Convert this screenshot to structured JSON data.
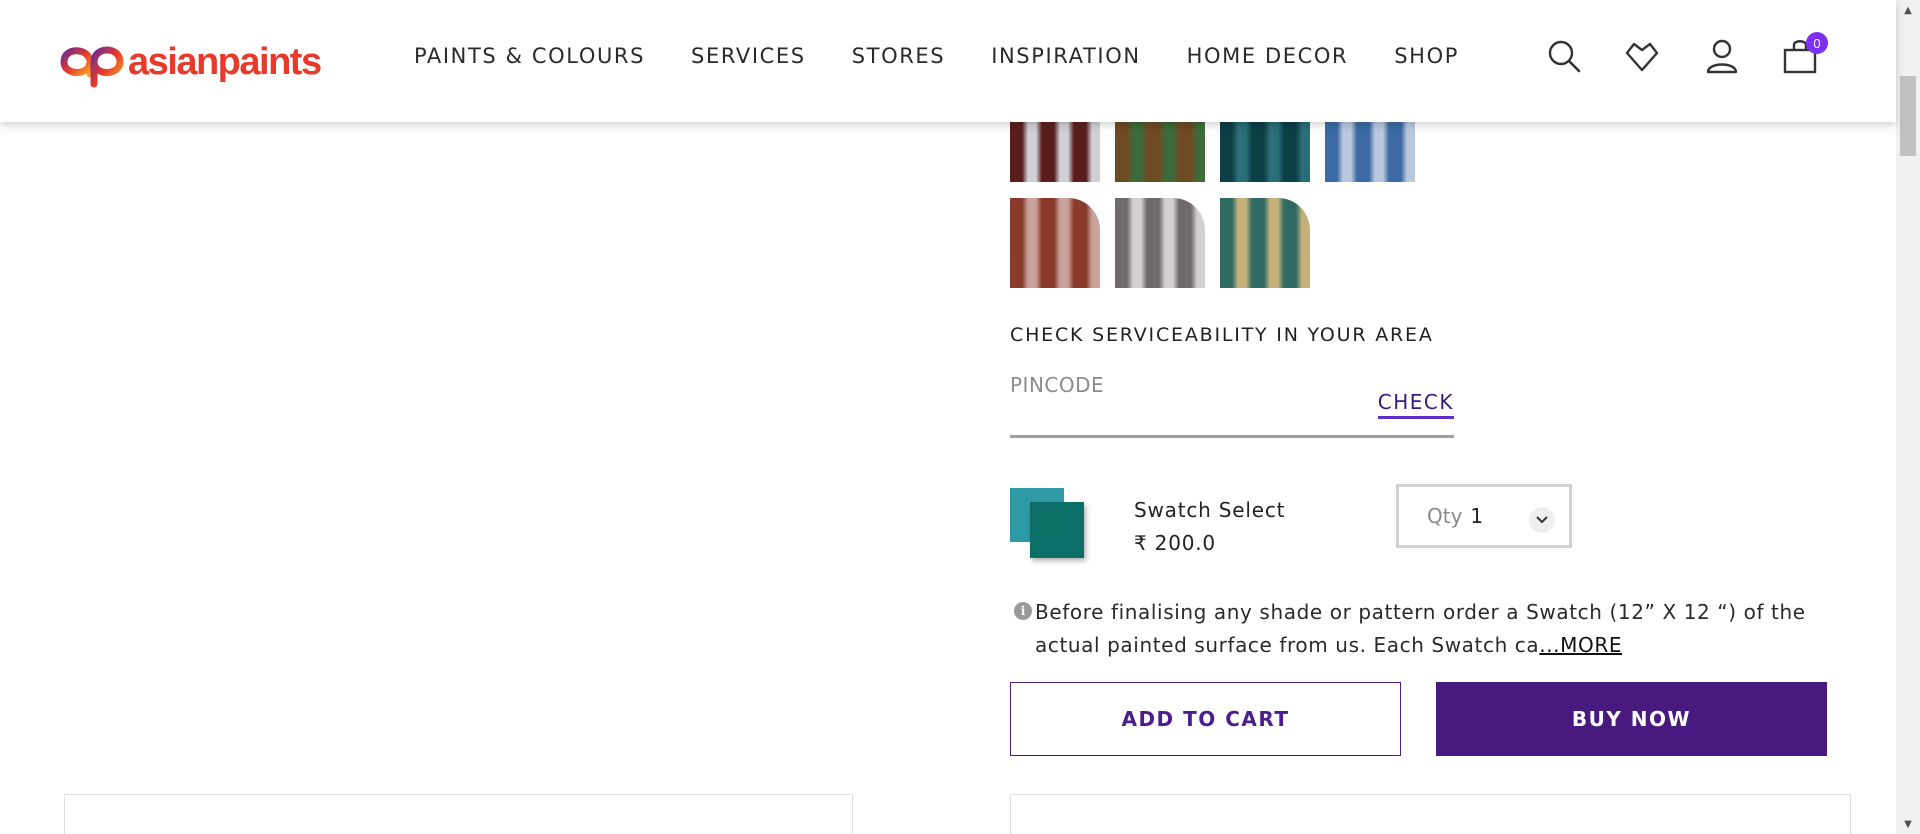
{
  "brand": {
    "name": "asianpaints"
  },
  "nav": {
    "items": [
      {
        "label": "PAINTS & COLOURS"
      },
      {
        "label": "SERVICES"
      },
      {
        "label": "STORES"
      },
      {
        "label": "INSPIRATION"
      },
      {
        "label": "HOME DECOR"
      },
      {
        "label": "SHOP"
      }
    ]
  },
  "header_icons": [
    "search-icon",
    "wishlist-heart-icon",
    "user-account-icon",
    "cart-bag-icon"
  ],
  "cart": {
    "count": "0"
  },
  "swatches": [
    {
      "name": "swatch-color-1",
      "selected": true,
      "colors": [
        "#5a1e1e",
        "#cfcfd4"
      ]
    },
    {
      "name": "swatch-color-2",
      "selected": false,
      "colors": [
        "#6e4a22",
        "#3f6b3a"
      ]
    },
    {
      "name": "swatch-color-3",
      "selected": false,
      "colors": [
        "#0d3f47",
        "#2a6e7a"
      ]
    },
    {
      "name": "swatch-color-4",
      "selected": false,
      "colors": [
        "#3c6aa4",
        "#b8c9de"
      ]
    },
    {
      "name": "swatch-color-5",
      "selected": false,
      "colors": [
        "#8a3a2a",
        "#caa39a"
      ]
    },
    {
      "name": "swatch-color-6",
      "selected": false,
      "colors": [
        "#6f6a6c",
        "#d2d0d3"
      ]
    },
    {
      "name": "swatch-color-7",
      "selected": false,
      "colors": [
        "#2f6b62",
        "#c6b07a"
      ]
    }
  ],
  "serviceability": {
    "title": "CHECK SERVICEABILITY IN YOUR AREA",
    "placeholder": "PINCODE",
    "check_label": "CHECK"
  },
  "swatch_select": {
    "name": "Swatch Select",
    "price": "₹ 200.0",
    "qty_label": "Qty",
    "qty_value": "1"
  },
  "info": {
    "text": "Before finalising any shade or pattern order a Swatch (12” X 12 “) of the actual painted surface from us. Each Swatch ca",
    "more_label": "...MORE"
  },
  "actions": {
    "add_to_cart": "ADD TO CART",
    "buy_now": "BUY NOW"
  },
  "colors": {
    "primary": "#481a80",
    "brand_red": "#e8392b",
    "cart_badge": "#7b2ff7"
  }
}
